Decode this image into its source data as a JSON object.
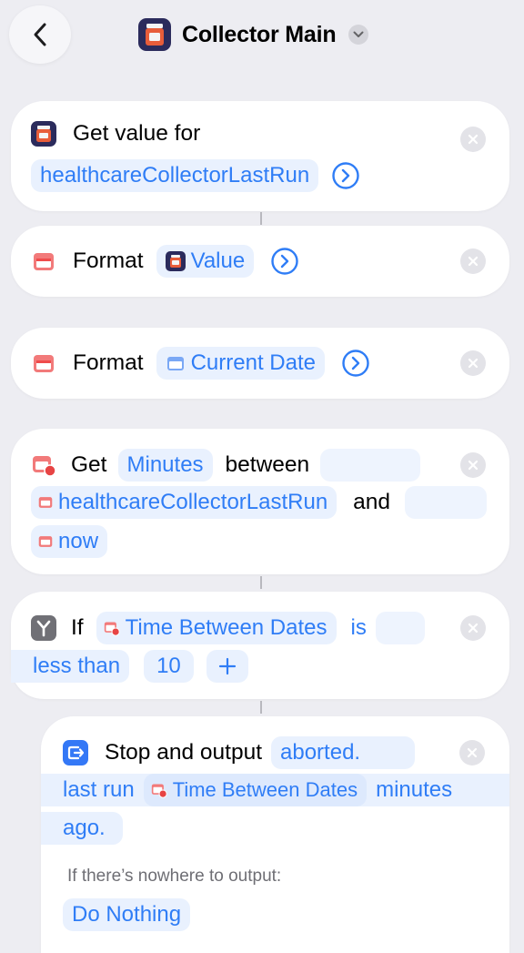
{
  "header": {
    "title": "Collector Main",
    "back_icon": "chevron-left-icon",
    "menu_icon": "chevron-down-icon",
    "app_icon": "shortcuts-app-icon"
  },
  "colors": {
    "accent": "#2f7df6",
    "background": "#ededf2",
    "card": "#ffffff"
  },
  "actions": [
    {
      "verb": "Get value for",
      "param": "healthcareCollectorLastRun",
      "icon": "app-icon"
    },
    {
      "verb": "Format",
      "param": "Value",
      "icon": "calendar-icon"
    },
    {
      "verb": "Format",
      "param": "Current Date",
      "icon": "calendar-icon"
    },
    {
      "verb": "Get",
      "unit": "Minutes",
      "between": "between",
      "param1": "healthcareCollectorLastRun",
      "and": "and",
      "param2": "now",
      "icon": "calendar-badge-icon"
    },
    {
      "verb": "If",
      "input": "Time Between Dates",
      "condition_is": "is",
      "condition": "less than",
      "value": "10",
      "add": "+",
      "icon": "branch-icon"
    },
    {
      "verb": "Stop and output",
      "text1": "aborted.",
      "text2": "last run",
      "var": "Time Between Dates",
      "text3": "minutes",
      "text4": "ago.",
      "fallback_label": "If there’s nowhere to output:",
      "fallback_value": "Do Nothing",
      "icon": "output-icon"
    }
  ]
}
